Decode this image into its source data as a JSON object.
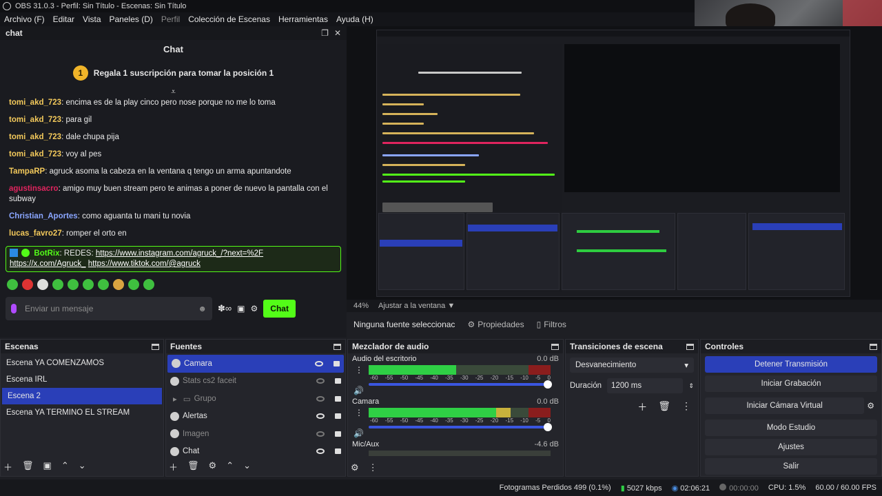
{
  "window": {
    "title": "OBS 31.0.3 - Perfil: Sin Título - Escenas: Sin Título"
  },
  "menu": [
    {
      "label": "Archivo (F)",
      "enabled": true
    },
    {
      "label": "Editar",
      "enabled": true
    },
    {
      "label": "Vista",
      "enabled": true
    },
    {
      "label": "Paneles (D)",
      "enabled": true
    },
    {
      "label": "Perfil",
      "enabled": false
    },
    {
      "label": "Colección de Escenas",
      "enabled": true
    },
    {
      "label": "Herramientas",
      "enabled": true
    },
    {
      "label": "Ayuda (H)",
      "enabled": true
    }
  ],
  "chat": {
    "dock_title": "chat",
    "header": "Chat",
    "promo": {
      "rank": "1",
      "text": "Regala 1 suscripción para tomar la posición 1"
    },
    "messages": [
      {
        "user": "tomi_akd_723",
        "sep": ": ",
        "text": "encima es de la play cinco pero nose porque no me lo toma",
        "color": "#f3c95b"
      },
      {
        "user": "tomi_akd_723",
        "sep": ": ",
        "text": "para gil",
        "color": "#f3c95b"
      },
      {
        "user": "tomi_akd_723",
        "sep": ": ",
        "text": "dale chupa pija",
        "color": "#f3c95b"
      },
      {
        "user": "tomi_akd_723",
        "sep": ": ",
        "text": "voy al pes",
        "color": "#f3c95b"
      },
      {
        "user": "TampaRP",
        "sep": ": ",
        "text": "agruck asoma la cabeza en la ventana q tengo un arma apuntandote",
        "color": "#f3c95b"
      },
      {
        "user": "agustinsacro",
        "sep": ": ",
        "text": "amigo muy buen stream pero te animas a poner de nuevo la pantalla con el subway",
        "color": "#e0245e"
      },
      {
        "user": "Christian_Aportes",
        "sep": ": ",
        "text": "como aguanta tu mani tu novia",
        "color": "#8aa6ff"
      },
      {
        "user": "lucas_favro27",
        "sep": ": ",
        "text": "romper el orto en",
        "color": "#f3c95b"
      }
    ],
    "bot": {
      "user": "BotRix",
      "prefix": ": REDES: ",
      "link1": "https://www.instagram.com/agruck_/?next=%2F",
      "link2": "https://x.com/Agruck_",
      "link3": "https://www.tiktok.com/@agruck",
      "color": "#53fc18"
    },
    "input_placeholder": "Enviar un mensaje",
    "send_label": "Chat"
  },
  "preview": {
    "zoom": "44%",
    "fit_label": "Ajustar a la ventana"
  },
  "source_toolbar": {
    "none_selected": "Ninguna fuente seleccionac",
    "properties": "Propiedades",
    "filters": "Filtros"
  },
  "scenes": {
    "title": "Escenas",
    "items": [
      {
        "label": "Escena YA COMENZAMOS",
        "selected": false
      },
      {
        "label": "Escena IRL",
        "selected": false
      },
      {
        "label": "Escena 2",
        "selected": true
      },
      {
        "label": "Escena YA TERMINO EL STREAM",
        "selected": false
      }
    ]
  },
  "sources": {
    "title": "Fuentes",
    "items": [
      {
        "label": "Camara",
        "selected": true,
        "visible": true,
        "dim": false,
        "group": false
      },
      {
        "label": "Stats cs2 faceit",
        "selected": false,
        "visible": false,
        "dim": true,
        "group": false
      },
      {
        "label": "Grupo",
        "selected": false,
        "visible": false,
        "dim": true,
        "group": true
      },
      {
        "label": "Alertas",
        "selected": false,
        "visible": true,
        "dim": false,
        "group": false
      },
      {
        "label": "Imagen",
        "selected": false,
        "visible": false,
        "dim": true,
        "group": false
      },
      {
        "label": "Chat",
        "selected": false,
        "visible": true,
        "dim": false,
        "group": false
      }
    ]
  },
  "mixer": {
    "title": "Mezclador de audio",
    "scale": [
      "-60",
      "-55",
      "-50",
      "-45",
      "-40",
      "-35",
      "-30",
      "-25",
      "-20",
      "-15",
      "-10",
      "-5",
      "0"
    ],
    "channels": [
      {
        "name": "Audio del escritorio",
        "db": "0.0 dB",
        "level_percent": 48
      },
      {
        "name": "Camara",
        "db": "0.0 dB",
        "level_percent": 78
      },
      {
        "name": "Mic/Aux",
        "db": "-4.6 dB",
        "level_percent": 0
      }
    ]
  },
  "transitions": {
    "title": "Transiciones de escena",
    "selected": "Desvanecimiento",
    "duration_label": "Duración",
    "duration": "1200 ms"
  },
  "controls": {
    "title": "Controles",
    "buttons": [
      "Detener Transmisión",
      "Iniciar Grabación",
      "Iniciar Cámara Virtual",
      "Modo Estudio",
      "Ajustes",
      "Salir"
    ]
  },
  "status": {
    "dropped": "Fotogramas Perdidos 499 (0.1%)",
    "bitrate": "5027 kbps",
    "stream_time": "02:06:21",
    "rec_time": "00:00:00",
    "cpu": "CPU: 1.5%",
    "fps": "60.00 / 60.00 FPS"
  },
  "colors": {
    "accent": "#2a3fb8",
    "kick_green": "#53fc18",
    "meter_green": "#2fcf45"
  }
}
